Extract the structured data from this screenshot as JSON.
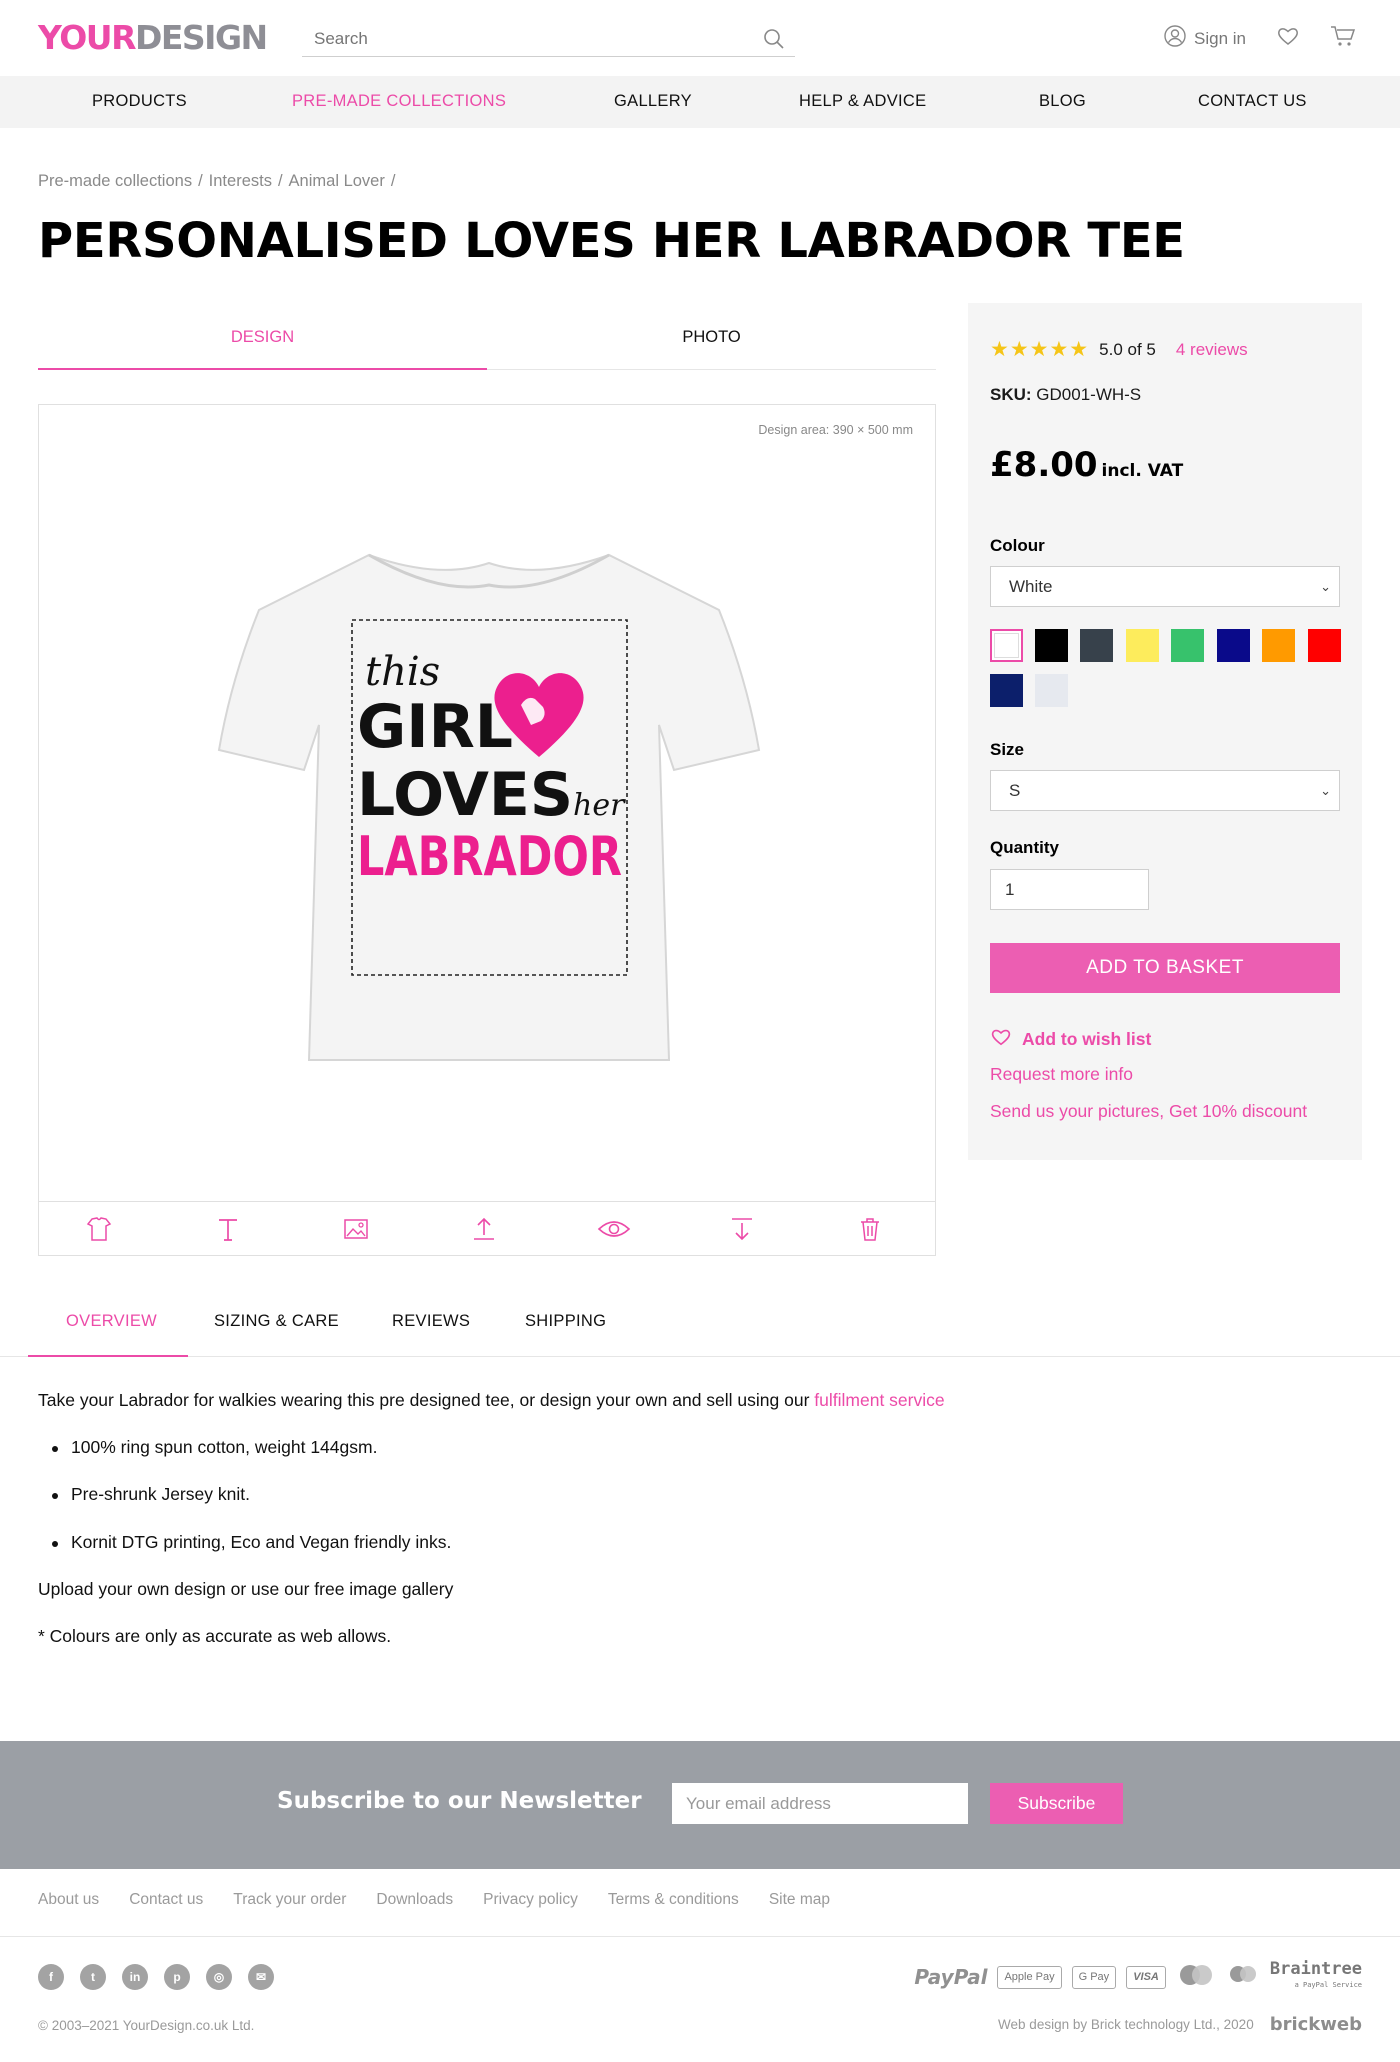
{
  "header": {
    "logo_part1": "YOUR",
    "logo_part2": "DESIGN",
    "search_placeholder": "Search",
    "signin_label": "Sign in"
  },
  "nav": {
    "items": [
      "PRODUCTS",
      "PRE-MADE COLLECTIONS",
      "GALLERY",
      "HELP & ADVICE",
      "BLOG",
      "CONTACT US"
    ],
    "active": "PRE-MADE COLLECTIONS"
  },
  "breadcrumbs": [
    "Pre-made collections",
    "Interests",
    "Animal Lover"
  ],
  "product": {
    "title": "PERSONALISED LOVES HER LABRADOR TEE",
    "design_tabs": [
      "DESIGN",
      "PHOTO"
    ],
    "design_area": "Design area: 390 × 500 mm",
    "artwork": {
      "line1": "this",
      "line2": "GIRL",
      "line3": "LOVES",
      "line4": "her",
      "line5": "LABRADOR"
    },
    "rating_text": "5.0 of 5",
    "reviews_link": "4 reviews",
    "sku_label": "SKU:",
    "sku": "GD001-WH-S",
    "price": "£8.00",
    "price_note": "incl. VAT",
    "colour_label": "Colour",
    "colour_selected": "White",
    "colour_swatches": [
      "#ffffff",
      "#000000",
      "#37414b",
      "#fdec5c",
      "#37c26c",
      "#0a0a8a",
      "#ff9a00",
      "#ff0000",
      "#0c1f6b",
      "#e6e9ef"
    ],
    "size_label": "Size",
    "size_selected": "S",
    "quantity_label": "Quantity",
    "quantity_value": "1",
    "add_button": "ADD TO BASKET",
    "wishlist": "Add to wish list",
    "request_info": "Request more info",
    "send_pictures": "Send us your pictures, Get 10% discount"
  },
  "info_tabs": [
    "OVERVIEW",
    "SIZING & CARE",
    "REVIEWS",
    "SHIPPING"
  ],
  "overview": {
    "intro": "Take your Labrador for walkies wearing this pre designed tee, or design your own and sell using our ",
    "intro_link": "fulfilment service",
    "bullets": [
      "100% ring spun cotton, weight 144gsm.",
      "Pre-shrunk Jersey knit.",
      "Kornit DTG printing, Eco and Vegan friendly inks."
    ],
    "line2": "Upload your own design or use our free image gallery",
    "line3": "* Colours are only as accurate as web allows."
  },
  "newsletter": {
    "title": "Subscribe to our Newsletter",
    "placeholder": "Your email address",
    "button": "Subscribe"
  },
  "footer": {
    "links": [
      "About us",
      "Contact us",
      "Track your order",
      "Downloads",
      "Privacy policy",
      "Terms & conditions",
      "Site map"
    ],
    "payments": [
      "PayPal",
      "Apple Pay",
      "G Pay",
      "VISA",
      "Braintree",
      "a PayPal Service"
    ],
    "copyright": "© 2003–2021 YourDesign.co.uk Ltd.",
    "credit": "Web design by Brick technology Ltd., 2020",
    "credit_brand": "brickweb"
  },
  "colors": {
    "accent": "#ec4ba8",
    "button": "#ec5eb2",
    "star": "#f5c518",
    "newsletter_bg": "#9b9fa5"
  }
}
